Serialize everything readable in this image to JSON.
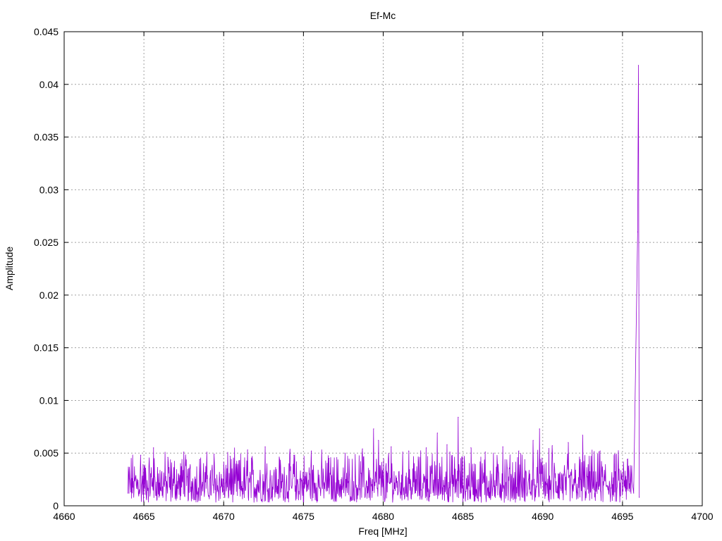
{
  "chart_data": {
    "type": "line",
    "title": "Ef-Mc",
    "xlabel": "Freq [MHz]",
    "ylabel": "Amplitude",
    "xlim": [
      4660,
      4700
    ],
    "ylim": [
      0,
      0.045
    ],
    "x_ticks": [
      "4660",
      "4665",
      "4670",
      "4675",
      "4680",
      "4685",
      "4690",
      "4695",
      "4700"
    ],
    "y_ticks": [
      "0",
      "0.005",
      "0.01",
      "0.015",
      "0.02",
      "0.025",
      "0.03",
      "0.035",
      "0.04",
      "0.045"
    ],
    "grid": true,
    "series": [
      {
        "color": "#9400d3",
        "noise_freq_range": [
          4664.0,
          4695.6
        ],
        "noise_amplitude_range": [
          0.0003,
          0.0057
        ],
        "x": [
          4664.0,
          4664.8,
          4665.6,
          4666.5,
          4667.5,
          4668.5,
          4669.4,
          4670.4,
          4671.5,
          4672.6,
          4673.5,
          4674.4,
          4675.5,
          4676.6,
          4677.6,
          4678.7,
          4679.4,
          4679.7,
          4680.5,
          4681.6,
          4682.7,
          4683.4,
          4684.0,
          4684.7,
          4685.5,
          4686.4,
          4687.5,
          4688.5,
          4689.4,
          4689.8,
          4690.6,
          4691.6,
          4692.5,
          4693.6,
          4694.5,
          4695.3,
          4695.7,
          4695.95,
          4696.0,
          4696.05
        ],
        "y": [
          0.0012,
          0.0048,
          0.0055,
          0.0046,
          0.0051,
          0.0044,
          0.0049,
          0.0047,
          0.0053,
          0.0056,
          0.0044,
          0.0048,
          0.0052,
          0.0045,
          0.005,
          0.0054,
          0.0073,
          0.0062,
          0.0056,
          0.0052,
          0.0055,
          0.0069,
          0.0058,
          0.0084,
          0.0055,
          0.0051,
          0.0056,
          0.0052,
          0.0062,
          0.0073,
          0.0057,
          0.006,
          0.0067,
          0.0052,
          0.0049,
          0.0044,
          0.0012,
          0.026,
          0.0418,
          0.0008
        ]
      }
    ]
  }
}
